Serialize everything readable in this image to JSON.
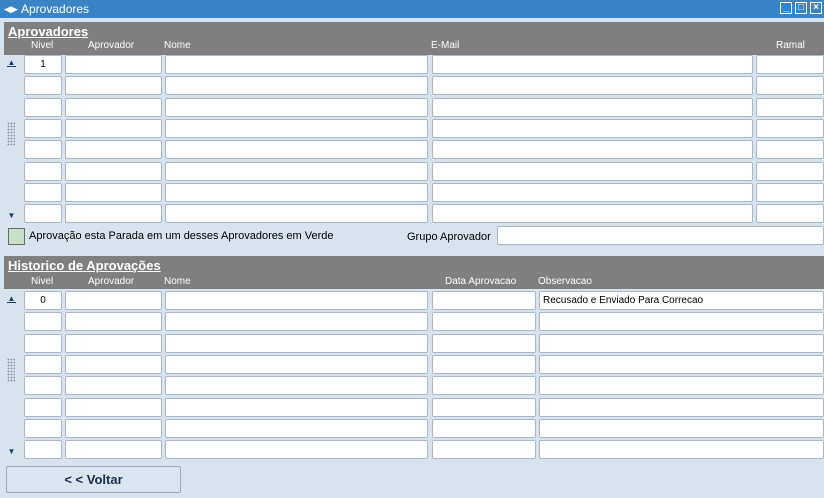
{
  "window": {
    "title": "Aprovadores"
  },
  "aprovadores": {
    "section_title": "Aprovadores",
    "columns": {
      "nivel": "Nivel",
      "aprovador": "Aprovador",
      "nome": "Nome",
      "email": "E-Mail",
      "ramal": "Ramal"
    },
    "rows": [
      {
        "nivel": "1",
        "aprovador": "",
        "nome": "",
        "email": "",
        "ramal": ""
      },
      {
        "nivel": "",
        "aprovador": "",
        "nome": "",
        "email": "",
        "ramal": ""
      },
      {
        "nivel": "",
        "aprovador": "",
        "nome": "",
        "email": "",
        "ramal": ""
      },
      {
        "nivel": "",
        "aprovador": "",
        "nome": "",
        "email": "",
        "ramal": ""
      },
      {
        "nivel": "",
        "aprovador": "",
        "nome": "",
        "email": "",
        "ramal": ""
      },
      {
        "nivel": "",
        "aprovador": "",
        "nome": "",
        "email": "",
        "ramal": ""
      },
      {
        "nivel": "",
        "aprovador": "",
        "nome": "",
        "email": "",
        "ramal": ""
      },
      {
        "nivel": "",
        "aprovador": "",
        "nome": "",
        "email": "",
        "ramal": ""
      }
    ]
  },
  "legend": {
    "text": "Aprovação esta Parada em um desses Aprovadores em Verde",
    "color": "#c8e0c8"
  },
  "grupo_aprovador": {
    "label": "Grupo Aprovador",
    "value": ""
  },
  "historico": {
    "section_title": "Historico de Aprovações",
    "columns": {
      "nivel": "Nivel",
      "aprovador": "Aprovador",
      "nome": "Nome",
      "data_aprovacao": "Data Aprovacao",
      "observacao": "Observacao"
    },
    "rows": [
      {
        "nivel": "0",
        "aprovador": "",
        "nome": "",
        "data_aprovacao": "",
        "observacao": "Recusado e Enviado Para Correcao"
      },
      {
        "nivel": "",
        "aprovador": "",
        "nome": "",
        "data_aprovacao": "",
        "observacao": ""
      },
      {
        "nivel": "",
        "aprovador": "",
        "nome": "",
        "data_aprovacao": "",
        "observacao": ""
      },
      {
        "nivel": "",
        "aprovador": "",
        "nome": "",
        "data_aprovacao": "",
        "observacao": ""
      },
      {
        "nivel": "",
        "aprovador": "",
        "nome": "",
        "data_aprovacao": "",
        "observacao": ""
      },
      {
        "nivel": "",
        "aprovador": "",
        "nome": "",
        "data_aprovacao": "",
        "observacao": ""
      },
      {
        "nivel": "",
        "aprovador": "",
        "nome": "",
        "data_aprovacao": "",
        "observacao": ""
      },
      {
        "nivel": "",
        "aprovador": "",
        "nome": "",
        "data_aprovacao": "",
        "observacao": ""
      }
    ]
  },
  "buttons": {
    "voltar": "< < Voltar"
  }
}
